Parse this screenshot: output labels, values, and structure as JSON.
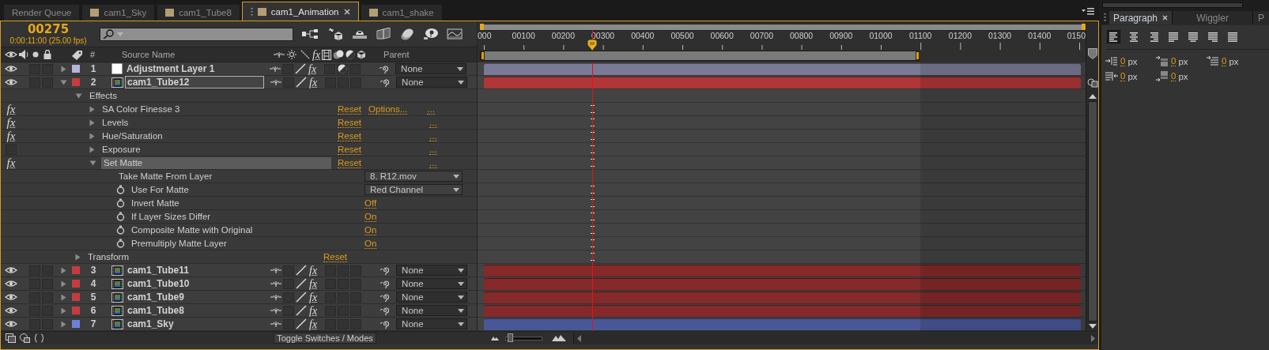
{
  "tabs": [
    {
      "label": "Render Queue",
      "kind": "panel",
      "selected": false
    },
    {
      "label": "cam1_Sky",
      "kind": "composition",
      "selected": false
    },
    {
      "label": "cam1_Tube8",
      "kind": "composition",
      "selected": false
    },
    {
      "label": "cam1_Animation",
      "kind": "composition",
      "selected": true
    },
    {
      "label": "cam1_shake",
      "kind": "composition",
      "selected": false
    }
  ],
  "composition": {
    "timecode": "00275",
    "time_detail": "0:00:11:00 (25.00 fps)"
  },
  "columns": {
    "number": "#",
    "source_name": "Source Name",
    "fx": "fx",
    "parent": "Parent"
  },
  "rows": [
    {
      "kind": "layer",
      "visible": true,
      "expanded": false,
      "color": "#b4b4dc",
      "number": "1",
      "source": {
        "kind": "adjustment"
      },
      "name": "Adjustment Layer 1",
      "selected": false,
      "fx_switch": "fx",
      "effects_on": true,
      "blend_switch": true,
      "parent": "None"
    },
    {
      "kind": "layer",
      "visible": true,
      "expanded": true,
      "color": "#c43c3e",
      "number": "2",
      "source": {
        "kind": "footage"
      },
      "name": "cam1_Tube12",
      "selected": true,
      "fx_switch": "fx",
      "effects_on": true,
      "blend_switch": false,
      "parent": "None"
    },
    {
      "kind": "group",
      "name": "Effects",
      "expanded": true
    },
    {
      "kind": "effect",
      "enabled": true,
      "fx_label": "fx",
      "expanded": false,
      "name": "SA Color Finesse 3",
      "selected": false,
      "reset": "Reset",
      "options": "Options...",
      "more": "..."
    },
    {
      "kind": "effect",
      "enabled": true,
      "fx_label": "fx",
      "expanded": false,
      "name": "Levels",
      "selected": false,
      "reset": "Reset",
      "more": "..."
    },
    {
      "kind": "effect",
      "enabled": true,
      "fx_label": "fx",
      "expanded": false,
      "name": "Hue/Saturation",
      "selected": false,
      "reset": "Reset",
      "more": "..."
    },
    {
      "kind": "effect",
      "enabled": false,
      "expanded": false,
      "name": "Exposure",
      "selected": false,
      "reset": "Reset",
      "more": "..."
    },
    {
      "kind": "effect",
      "enabled": true,
      "fx_label": "fx",
      "expanded": true,
      "name": "Set Matte",
      "selected": true,
      "reset": "Reset",
      "more": "..."
    },
    {
      "kind": "property",
      "stopwatch": false,
      "name": "Take Matte From Layer",
      "value": {
        "kind": "dropdown",
        "text": "8. R12.mov"
      }
    },
    {
      "kind": "property",
      "stopwatch": true,
      "name": "Use For Matte",
      "value": {
        "kind": "dropdown",
        "text": "Red Channel"
      }
    },
    {
      "kind": "property",
      "stopwatch": true,
      "name": "Invert Matte",
      "value": {
        "kind": "link",
        "text": "Off"
      }
    },
    {
      "kind": "property",
      "stopwatch": true,
      "name": "If Layer Sizes Differ",
      "value": {
        "kind": "link",
        "text": "On"
      }
    },
    {
      "kind": "property",
      "stopwatch": true,
      "name": "Composite Matte with Original",
      "value": {
        "kind": "link",
        "text": "On"
      }
    },
    {
      "kind": "property",
      "stopwatch": true,
      "name": "Premultiply Matte Layer",
      "value": {
        "kind": "link",
        "text": "On"
      }
    },
    {
      "kind": "group",
      "name": "Transform",
      "expanded": false,
      "reset": "Reset"
    },
    {
      "kind": "layer",
      "visible": true,
      "expanded": false,
      "color": "#c43c3e",
      "number": "3",
      "source": {
        "kind": "footage"
      },
      "name": "cam1_Tube11",
      "selected": false,
      "fx_switch": "fx",
      "effects_on": true,
      "blend_switch": false,
      "parent": "None"
    },
    {
      "kind": "layer",
      "visible": true,
      "expanded": false,
      "color": "#c43c3e",
      "number": "4",
      "source": {
        "kind": "footage"
      },
      "name": "cam1_Tube10",
      "selected": false,
      "fx_switch": "fx",
      "effects_on": true,
      "blend_switch": false,
      "parent": "None"
    },
    {
      "kind": "layer",
      "visible": true,
      "expanded": false,
      "color": "#c43c3e",
      "number": "5",
      "source": {
        "kind": "footage"
      },
      "name": "cam1_Tube9",
      "selected": false,
      "fx_switch": "fx",
      "effects_on": true,
      "blend_switch": false,
      "parent": "None"
    },
    {
      "kind": "layer",
      "visible": true,
      "expanded": false,
      "color": "#c43c3e",
      "number": "6",
      "source": {
        "kind": "footage"
      },
      "name": "cam1_Tube8",
      "selected": false,
      "fx_switch": "fx",
      "effects_on": true,
      "blend_switch": false,
      "parent": "None"
    },
    {
      "kind": "layer",
      "visible": true,
      "expanded": false,
      "color": "#6c80e0",
      "number": "7",
      "source": {
        "kind": "footage"
      },
      "name": "cam1_Sky",
      "selected": false,
      "fx_switch": "fx",
      "effects_on": true,
      "blend_switch": false,
      "parent": "None"
    }
  ],
  "timeline": {
    "ruler_labels": [
      "000",
      "00100",
      "00200",
      "00300",
      "00400",
      "00500",
      "00600",
      "00700",
      "00800",
      "00900",
      "01000",
      "01100",
      "01200",
      "01300",
      "01400",
      "0150"
    ],
    "playhead": {
      "level": 0.189
    },
    "work_area": {
      "level": 0.728
    },
    "zoom_slider": {
      "level": 0.05
    }
  },
  "footer": {
    "toggle_button": "Toggle Switches / Modes"
  },
  "paragraph_panel": {
    "tabs": [
      {
        "label": "Paragraph",
        "selected": true
      },
      {
        "label": "Wiggler",
        "selected": false
      },
      {
        "label": "P",
        "selected": false
      }
    ],
    "align_buttons": [
      {
        "kind": "left",
        "selected": true
      },
      {
        "kind": "center",
        "selected": false
      },
      {
        "kind": "right",
        "selected": false
      },
      {
        "kind": "justify-left",
        "selected": false
      },
      {
        "kind": "justify-center",
        "selected": false
      },
      {
        "kind": "justify-right",
        "selected": false
      },
      {
        "kind": "justify-all",
        "selected": false
      }
    ],
    "indents": [
      {
        "kind": "indent-left",
        "value": "0",
        "unit": "px"
      },
      {
        "kind": "space-before",
        "value": "0",
        "unit": "px"
      },
      {
        "kind": "indent-first-line",
        "value": "0",
        "unit": "px"
      },
      {
        "kind": "indent-right",
        "value": "0",
        "unit": "px"
      },
      {
        "kind": "space-after",
        "value": "0",
        "unit": "px"
      }
    ]
  }
}
